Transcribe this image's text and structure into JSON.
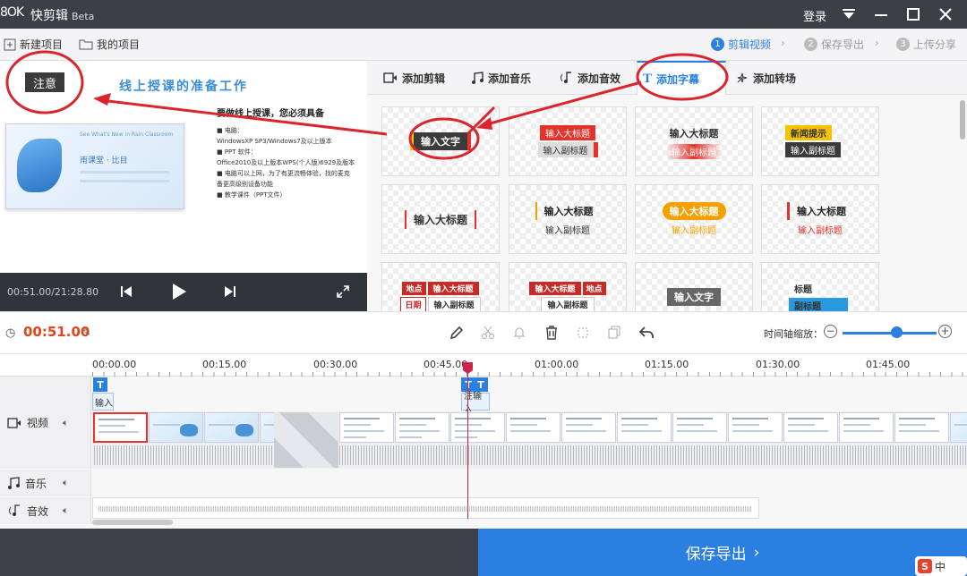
{
  "app": {
    "logo": "8OK",
    "name": "快剪辑",
    "badge": "Beta",
    "login": "登录"
  },
  "menu": {
    "new_project": "新建项目",
    "my_projects": "我的项目"
  },
  "steps": [
    {
      "num": "1",
      "label": "剪辑视频",
      "active": true
    },
    {
      "num": "2",
      "label": "保存导出",
      "active": false
    },
    {
      "num": "3",
      "label": "上传分享",
      "active": false
    }
  ],
  "preview": {
    "notice": "注意",
    "slide_title": "线上授课的准备工作",
    "thumb_line1": "See What's New in Rain Classroom",
    "thumb_line2": "雨课堂 · 比目",
    "body_heading": "要做线上授课，您必须具备",
    "body_lines": [
      "■ 电脑：",
      "WindowsXP SP3/Windows7及以上版本",
      "■ PPT 软件：",
      "Office2010及以上版本WPS(个人版)6929及版本",
      "■ 电脑可以上网，为了有更流畅体验，找的麦克",
      "备更高级别设备功能",
      "■ 教学课件（PPT文件）"
    ],
    "time": "00:51.00/21:28.80"
  },
  "tabs": [
    {
      "icon": "video-icon",
      "label": "添加剪辑"
    },
    {
      "icon": "music-icon",
      "label": "添加音乐"
    },
    {
      "icon": "sound-effect-icon",
      "label": "添加音效"
    },
    {
      "icon": "text-icon",
      "label": "添加字幕",
      "active": true
    },
    {
      "icon": "transition-icon",
      "label": "添加转场"
    }
  ],
  "subtitle_templates": [
    {
      "main": "输入文字"
    },
    {
      "main": "输入大标题",
      "sub": "输入副标题"
    },
    {
      "main": "输入大标题",
      "sub": "输入副标题"
    },
    {
      "main": "新闻提示",
      "sub": "输入副标题"
    },
    {
      "main": "输入大标题"
    },
    {
      "main": "输入大标题",
      "sub": "输入副标题"
    },
    {
      "main": "输入大标题",
      "sub": "输入副标题"
    },
    {
      "main": "输入大标题",
      "sub": "输入副标题"
    },
    {
      "tag1": "地点",
      "tag2": "日期",
      "main": "输入大标题",
      "sub": "输入副标题"
    },
    {
      "tag1": "地点",
      "main": "输入大标题",
      "sub": "输入副标题"
    },
    {
      "main": "输入文字"
    },
    {
      "main": "标题",
      "sub": "副标题"
    }
  ],
  "toolbar": {
    "current_time": "00:51.00",
    "zoom_label": "时间轴缩放："
  },
  "ruler": [
    "00:00.00",
    "00:15.00",
    "00:30.00",
    "00:45.00",
    "01:00.00",
    "01:15.00",
    "01:30.00",
    "01:45.00"
  ],
  "tracks": {
    "video": "视频",
    "music": "音乐",
    "effects": "音效"
  },
  "subtitle_clips": [
    {
      "label": "输入"
    },
    {
      "label": "注输入"
    }
  ],
  "export_button": "保存导出",
  "ime": {
    "icon": "S",
    "label": "中"
  },
  "colors": {
    "accent": "#2a7fe0",
    "playhead": "#d0234b",
    "annotation": "#d9262c",
    "current_time": "#e0461a"
  }
}
